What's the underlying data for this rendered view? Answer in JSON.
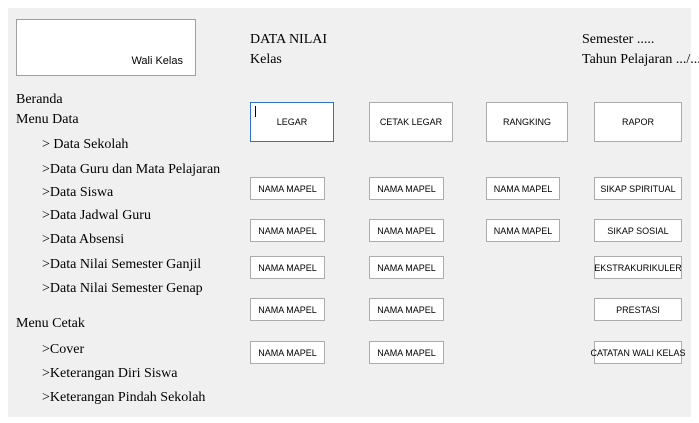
{
  "wali_kelas_box": {
    "label": "Wali Kelas"
  },
  "header": {
    "title": "DATA NILAI",
    "kelas": "Kelas",
    "semester": "Semester .....",
    "tahun": "Tahun Pelajaran .../..."
  },
  "menu": {
    "beranda": "Beranda",
    "menu_data": "Menu Data",
    "data_items": [
      "> Data Sekolah",
      ">Data Guru dan Mata Pelajaran",
      ">Data Siswa",
      ">Data Jadwal Guru",
      ">Data Absensi",
      ">Data Nilai Semester Ganjil",
      ">Data Nilai Semester Genap"
    ],
    "menu_cetak": "Menu Cetak",
    "cetak_items": [
      ">Cover",
      ">Keterangan Diri Siswa",
      ">Keterangan Pindah Sekolah"
    ]
  },
  "top_buttons": [
    "LEGAR",
    "CETAK LEGAR",
    "RANGKING",
    "RAPOR"
  ],
  "mapel_label": "NAMA MAPEL",
  "right_buttons": [
    "SIKAP SPIRITUAL",
    "SIKAP SOSIAL",
    "EKSTRAKURIKULER",
    "PRESTASI",
    "CATATAN WALI KELAS"
  ]
}
